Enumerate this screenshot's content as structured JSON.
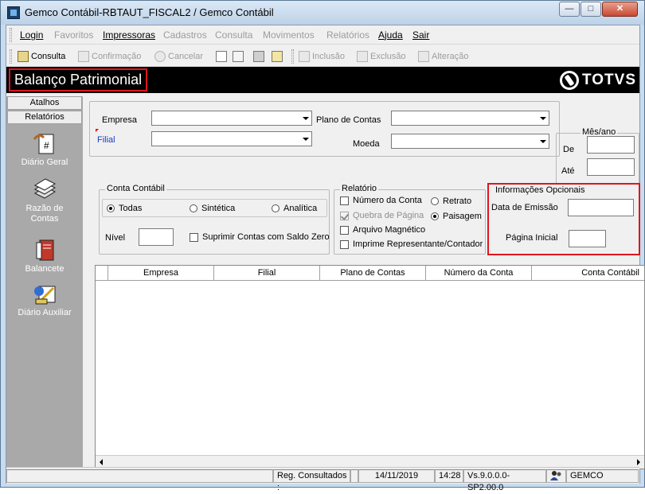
{
  "window": {
    "title": "Gemco Contábil-RBTAUT_FISCAL2 / Gemco Contábil",
    "minimize": "—",
    "maximize": "□",
    "close": "✕"
  },
  "menu": [
    {
      "label": "Login",
      "enabled": true
    },
    {
      "label": "Favoritos",
      "enabled": false
    },
    {
      "label": "Impressoras",
      "enabled": true
    },
    {
      "label": "Cadastros",
      "enabled": false
    },
    {
      "label": "Consulta",
      "enabled": false
    },
    {
      "label": "Movimentos",
      "enabled": false
    },
    {
      "label": "Relatórios",
      "enabled": false
    },
    {
      "label": "Ajuda",
      "enabled": true
    },
    {
      "label": "Sair",
      "enabled": true
    }
  ],
  "toolbar": {
    "consulta": "Consulta",
    "confirmacao": "Confirmação",
    "cancelar": "Cancelar",
    "inclusao": "Inclusão",
    "exclusao": "Exclusão",
    "alteracao": "Alteração"
  },
  "banner": {
    "title": "Balanço Patrimonial",
    "logo": "TOTVS"
  },
  "sidebar": {
    "tab_atalhos": "Atalhos",
    "tab_relatorios": "Relatórios",
    "items": [
      {
        "label": "Diário Geral",
        "icon": "ledger-hash-icon"
      },
      {
        "label": "Razão de Contas",
        "icon": "book-stack-icon"
      },
      {
        "label": "Balancete",
        "icon": "balance-book-icon"
      },
      {
        "label": "Diário Auxiliar",
        "icon": "aux-journal-icon"
      }
    ]
  },
  "filters": {
    "empresa_label": "Empresa",
    "empresa_value": "",
    "filial_label": "Filial",
    "filial_value": "",
    "plano_label": "Plano de Contas",
    "plano_value": "",
    "moeda_label": "Moeda",
    "moeda_value": ""
  },
  "mesano": {
    "legend": "Mês/ano",
    "de_label": "De",
    "de_value": "",
    "ate_label": "Até",
    "ate_value": ""
  },
  "conta": {
    "legend": "Conta Contábil",
    "opt_todas": "Todas",
    "opt_sinteticas": "Sintética",
    "opt_analiticas": "Analítica",
    "selected": "Todas",
    "nivel_label": "Nível",
    "nivel_value": "",
    "suprimir_label": "Suprimir Contas com Saldo Zero"
  },
  "relatorio": {
    "legend": "Relatório",
    "numero_conta": "Número da Conta",
    "quebra_pagina": "Quebra de Página",
    "arquivo_magnetico": "Arquivo Magnético",
    "imprime_representante": "Imprime Representante/Contador",
    "retrato": "Retrato",
    "paisagem": "Paisagem",
    "orientation": "Paisagem"
  },
  "opcionais": {
    "legend": "Informações Opcionais",
    "data_emissao_label": "Data de Emissão",
    "data_emissao_value": "",
    "pagina_inicial_label": "Página Inicial",
    "pagina_inicial_value": ""
  },
  "grid": {
    "columns": [
      "Empresa",
      "Filial",
      "Plano de Contas",
      "Número da Conta",
      "Conta Contábil"
    ]
  },
  "status": {
    "reg_label": "Reg. Consultados :",
    "reg_value": "",
    "date": "14/11/2019",
    "time": "14:28",
    "version": "Vs.9.0.0.0-SP2.00.0",
    "user": "GEMCO"
  },
  "colors": {
    "banner_bg": "#000000",
    "highlight_border": "#e0141e",
    "sidebar_bg": "#a9a9a9",
    "filial_label": "#1a3cc2"
  }
}
